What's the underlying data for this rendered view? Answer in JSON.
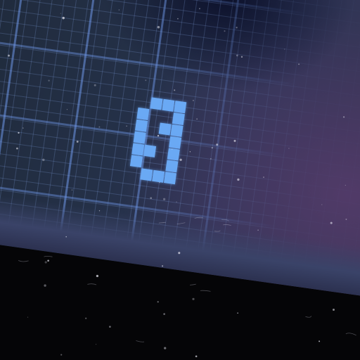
{
  "scene": {
    "description_tag": "photo-of-pixel-display",
    "digit": {
      "shape_rows": [
        ".###",
        "#..#",
        "#.##",
        "#..#",
        "##.#",
        "#..#",
        ".###"
      ]
    },
    "colors": {
      "digit": "#6aa9f4",
      "screen_base": "#243047",
      "glare": "#5a3c6e",
      "bezel": "#050507"
    }
  }
}
